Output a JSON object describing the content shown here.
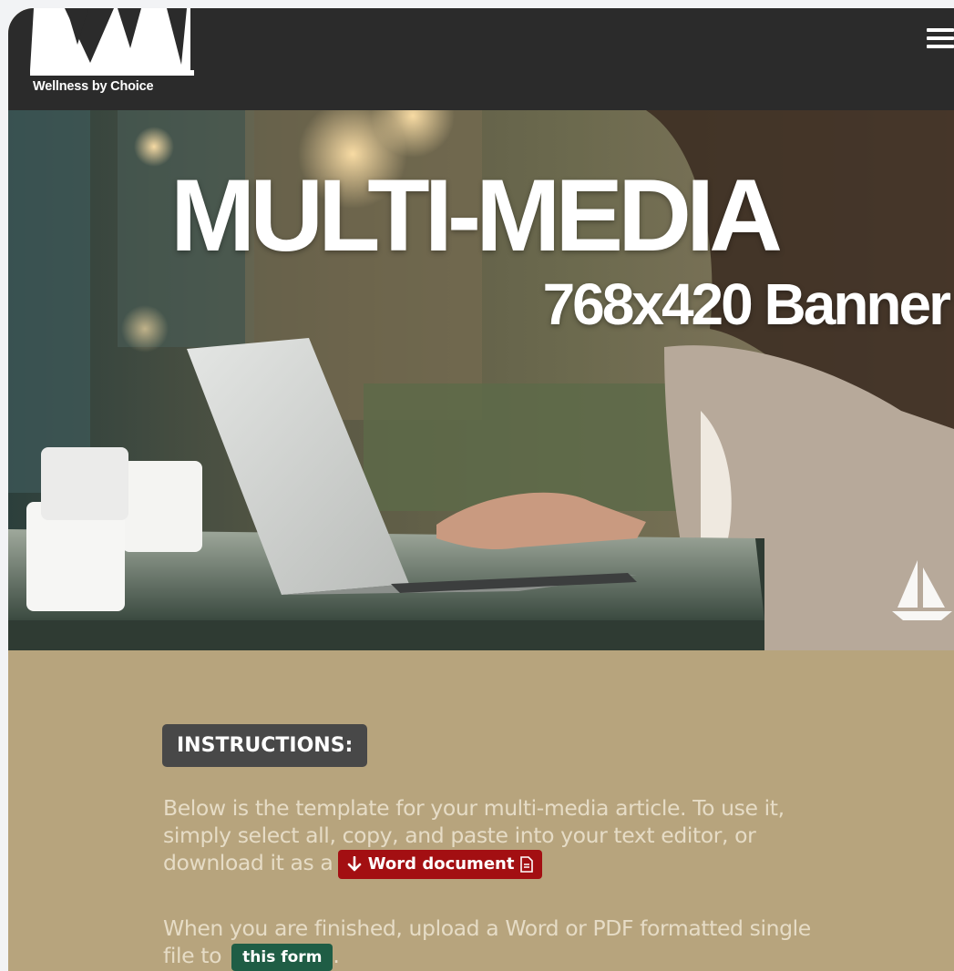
{
  "header": {
    "logo_text": "Wellness by Choice",
    "menu_icon": "hamburger-menu-icon"
  },
  "banner": {
    "title": "MULTI-MEDIA",
    "subtitle": "768x420 Banner",
    "watermark_icon": "sailboat-icon"
  },
  "instructions": {
    "badge_label": "INSTRUCTIONS:",
    "para1_text": "Below is the template for your multi-media article. To use it, simply select all, copy, and paste into your text editor, or download it as a",
    "word_button_label": "Word document",
    "word_button_icons": [
      "arrow-down-icon",
      "file-icon"
    ],
    "para2_text": "When you are finished, upload a Word or PDF formatted single file to",
    "form_button_label": "this form",
    "para2_suffix": "."
  },
  "colors": {
    "header_bg": "#2b2b2b",
    "content_bg": "#b7a47d",
    "badge_bg": "#484848",
    "word_button_bg": "#a30f12",
    "form_button_bg": "#1f5d45",
    "para_text": "#e6dcc6"
  }
}
